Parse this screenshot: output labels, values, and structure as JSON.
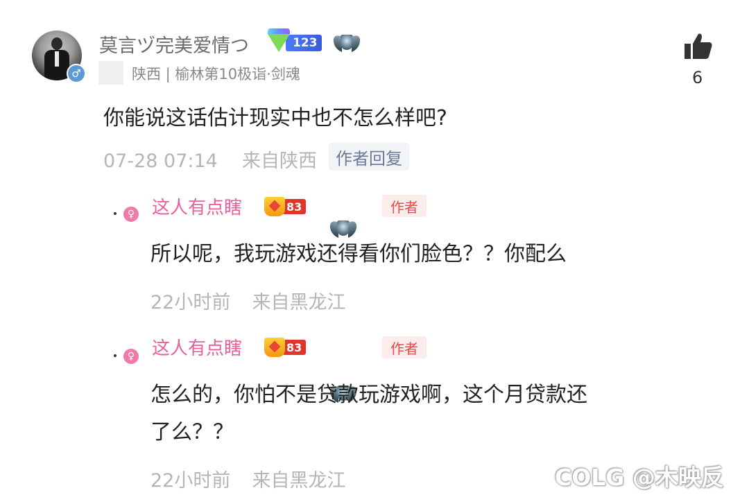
{
  "main_comment": {
    "username": "莫言ヅ完美爱情つ",
    "level": "123",
    "location_line": "陕西 | 榆林第10极诣·剑魂",
    "text": "你能说这话估计现实中也不怎么样吧?",
    "time": "07-28 07:14",
    "from": "来自陕西",
    "author_reply_tag": "作者回复",
    "like_count": "6",
    "gender_icon": "male-icon"
  },
  "replies": [
    {
      "username": "这人有点瞎",
      "level": "83",
      "tag": "作者",
      "text": "所以呢，我玩游戏还得看你们脸色？？你配么",
      "time": "22小时前",
      "from": "来自黑龙江",
      "gender_icon": "female-icon"
    },
    {
      "username": "这人有点瞎",
      "level": "83",
      "tag": "作者",
      "text_line1": "怎么的，你怕不是贷款玩游戏啊，这个月贷款还",
      "text_line2": "了么？？",
      "time": "22小时前",
      "from": "来自黑龙江",
      "gender_icon": "female-icon"
    }
  ],
  "watermark": "COLG @木映反",
  "colors": {
    "username_main": "#6b6b6b",
    "username_reply": "#e85f9b",
    "author_tag_bg": "#fdecec",
    "author_tag_text": "#e04b4b",
    "meta_text": "#b5b5b5"
  }
}
